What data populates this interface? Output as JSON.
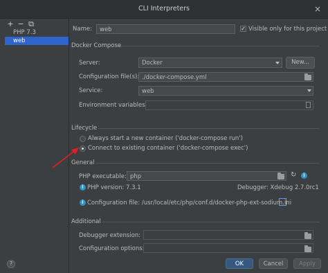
{
  "window": {
    "title": "CLI Interpreters",
    "close_glyph": "×"
  },
  "toolbar": {
    "add_glyph": "+",
    "remove_glyph": "−",
    "copy_glyph": "⧉"
  },
  "interpreters": [
    "PHP 7.3",
    "web"
  ],
  "form": {
    "name_label": "Name:",
    "name_value": "web",
    "visible_only_label": "Visible only for this project",
    "visible_only_checked": true
  },
  "docker_compose": {
    "section_title": "Docker Compose",
    "server_label": "Server:",
    "server_value": "Docker",
    "new_button": "New...",
    "config_files_label": "Configuration file(s):",
    "config_files_value": "./docker-compose.yml",
    "service_label": "Service:",
    "service_value": "web",
    "env_vars_label": "Environment variables:",
    "env_vars_value": ""
  },
  "lifecycle": {
    "section_title": "Lifecycle",
    "option_run": "Always start a new container ('docker-compose run')",
    "option_exec": "Connect to existing container ('docker-compose exec')",
    "selected": "exec"
  },
  "general": {
    "section_title": "General",
    "php_exec_label": "PHP executable:",
    "php_exec_value": "php",
    "php_version": "PHP version: 7.3.1",
    "debugger": "Debugger: Xdebug 2.7.0rc1",
    "config_file": "Configuration file: /usr/local/etc/php/conf.d/docker-php-ext-sodium.ini"
  },
  "additional": {
    "section_title": "Additional",
    "debugger_ext_label": "Debugger extension:",
    "debugger_ext_value": "",
    "config_options_label": "Configuration options:",
    "config_options_value": ""
  },
  "buttons": {
    "ok": "OK",
    "cancel": "Cancel",
    "apply": "Apply",
    "help": "?"
  },
  "colors": {
    "accent": "#2f65ca",
    "annotation_arrow": "#e02020",
    "link": "#589df6",
    "info": "#3592c4"
  },
  "icons": [
    "add-icon",
    "remove-icon",
    "copy-icon",
    "folder-icon",
    "refresh-icon",
    "info-icon",
    "edit-icon",
    "help-icon",
    "close-icon",
    "dropdown-arrow-icon"
  ]
}
